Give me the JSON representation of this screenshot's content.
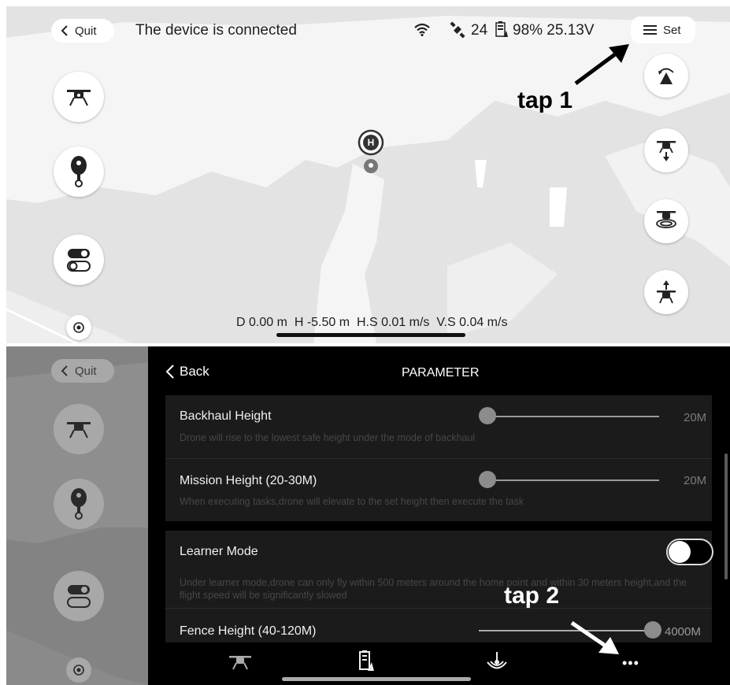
{
  "top": {
    "quit_label": "Quit",
    "status": "The device is connected",
    "satellites": "24",
    "battery": "98% 25.13V",
    "set_label": "Set",
    "annotation": "tap 1",
    "home_marker": "H",
    "telemetry": {
      "distance": "D 0.00 m",
      "height": "H -5.50 m",
      "h_speed": "H.S 0.01 m/s",
      "v_speed": "V.S 0.04 m/s"
    }
  },
  "bottom": {
    "quit_label": "Quit",
    "back_label": "Back",
    "title": "PARAMETER",
    "annotation": "tap 2",
    "more_label": "•••",
    "params": [
      {
        "title": "Backhaul Height",
        "desc": "Drone will rise to the lowest safe height under the mode of backhaul",
        "value": "20M",
        "level": 0
      },
      {
        "title": "Mission Height (20-30M)",
        "desc": "When executing tasks,drone will elevate to the set height then execute the task",
        "value": "20M",
        "level": 0
      },
      {
        "title": "Learner Mode",
        "desc": "Under learner mode,drone can only fly within 500 meters around the home point and within 30 meters height,and the flight speed will be significantly slowed",
        "toggle": false
      },
      {
        "title": "Fence Height (40-120M)",
        "value": "4000M",
        "level": 1
      }
    ]
  },
  "icons": [
    "back-chevron-icon",
    "wifi-icon",
    "satellite-icon",
    "battery-icon",
    "menu-icon",
    "drone-icon",
    "remote-controller-icon",
    "toggle-switch-icon",
    "locate-icon",
    "return-home-icon",
    "land-icon",
    "hover-icon",
    "takeoff-icon",
    "home-marker-icon",
    "arrow-icon",
    "antenna-signal-icon",
    "more-icon"
  ],
  "colors": {
    "map_land": "#e2e2e2",
    "map_shape": "#f4f4f4",
    "dark_panel": "#000000",
    "card": "#1b1b1b"
  }
}
